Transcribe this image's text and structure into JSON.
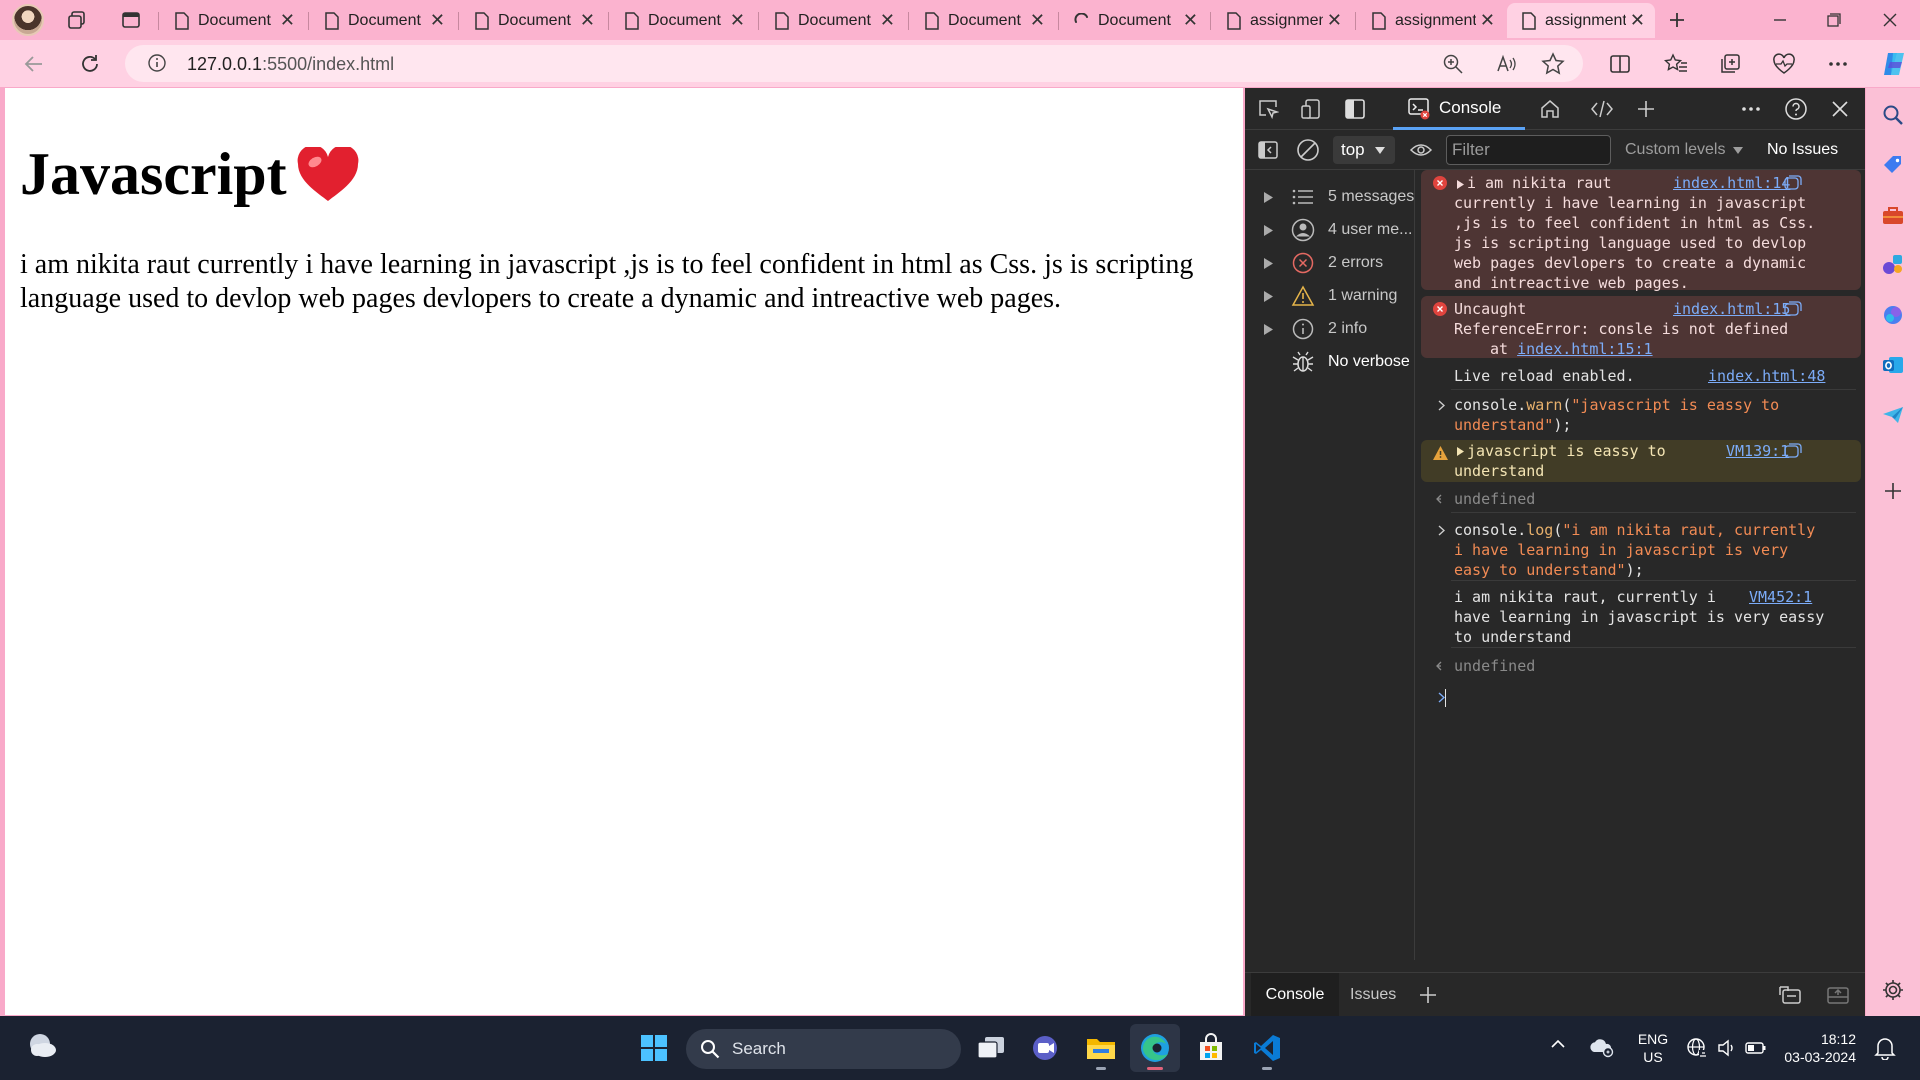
{
  "browser": {
    "tabs": [
      {
        "label": "Document",
        "icon": "page-icon"
      },
      {
        "label": "Document",
        "icon": "page-icon"
      },
      {
        "label": "Document",
        "icon": "page-icon"
      },
      {
        "label": "Document",
        "icon": "page-icon"
      },
      {
        "label": "Document",
        "icon": "page-icon"
      },
      {
        "label": "Document",
        "icon": "page-icon"
      },
      {
        "label": "Document",
        "icon": "loading-spinner-icon"
      },
      {
        "label": "assignment",
        "icon": "page-icon"
      },
      {
        "label": "assignment",
        "icon": "page-icon"
      },
      {
        "label": "assignment",
        "icon": "page-icon",
        "active": true
      }
    ],
    "close_glyph": "✕",
    "address": {
      "host": "127.0.0.1",
      "port_path": ":5500/index.html"
    }
  },
  "page": {
    "heading": "Javascript",
    "paragraph": "i am nikita raut currently i have learning in javascript ,js is to feel confident in html as Css. js is scripting language used to devlop web pages devlopers to create a dynamic and intreactive web pages."
  },
  "devtools": {
    "active_tab": "Console",
    "context": "top",
    "filter_placeholder": "Filter",
    "levels_label": "Custom levels",
    "issues_label": "No Issues",
    "sidebar": [
      {
        "label": "5 messages",
        "icon": "list-icon"
      },
      {
        "label": "4 user me...",
        "icon": "user-icon"
      },
      {
        "label": "2 errors",
        "icon": "error-icon"
      },
      {
        "label": "1 warning",
        "icon": "warning-icon"
      },
      {
        "label": "2 info",
        "icon": "info-icon"
      },
      {
        "label": "No verbose",
        "icon": "bug-icon"
      }
    ],
    "messages": [
      {
        "type": "error",
        "text": "i am nikita raut\ncurrently i have learning in javascript\n,js is to feel confident in html as Css.\njs is scripting language used to devlop\nweb pages devlopers to create a dynamic\nand intreactive web pages.",
        "source": "index.html:14"
      },
      {
        "type": "error",
        "text": "Uncaught\nReferenceError: consle is not defined",
        "at_prefix": "at ",
        "at_link": "index.html:15:1",
        "source": "index.html:15"
      },
      {
        "type": "log",
        "text": "Live reload enabled.",
        "source": "index.html:48"
      },
      {
        "type": "input",
        "parts": [
          "console.",
          "warn",
          "(",
          "\"javascript is eassy to\nunderstand\"",
          ");"
        ]
      },
      {
        "type": "warn",
        "text": "javascript is eassy to\nunderstand",
        "source": "VM139:1"
      },
      {
        "type": "result",
        "text": "undefined"
      },
      {
        "type": "input",
        "parts": [
          "console.",
          "log",
          "(",
          "\"i am nikita raut, currently\ni have learning in javascript is very\neasy to understand\"",
          ");"
        ]
      },
      {
        "type": "log",
        "text": "i am nikita raut, currently i\nhave learning in javascript is very eassy\nto understand",
        "source": "VM452:1"
      },
      {
        "type": "result",
        "text": "undefined"
      }
    ],
    "drawer_tabs": [
      "Console",
      "Issues"
    ]
  },
  "taskbar": {
    "search_label": "Search",
    "language": [
      "ENG",
      "US"
    ],
    "time": "18:12",
    "date": "03-03-2024"
  },
  "colors": {
    "frame_pink": "#f9a9c9",
    "devtools_bg": "#282828",
    "error_bg": "#4e3534",
    "warn_bg": "#413c26",
    "link_blue": "#7cacf8",
    "taskbar_bg": "#1b2231"
  }
}
